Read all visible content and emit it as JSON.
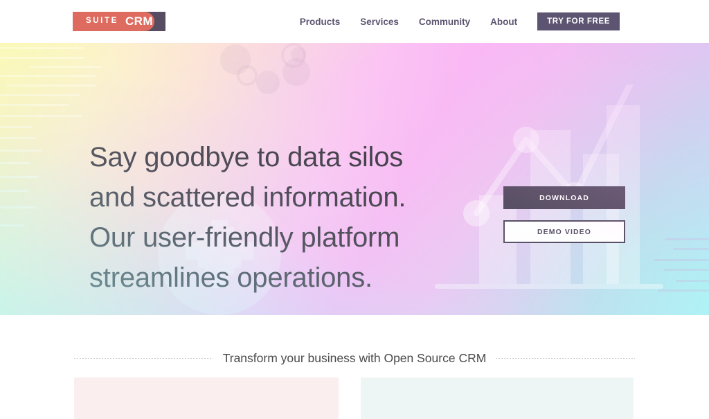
{
  "header": {
    "logo": {
      "left_text": "SUITE",
      "right_text": "CRM",
      "left_color": "#DE6B60",
      "right_color": "#574D63"
    },
    "nav_items": [
      {
        "label": "Products"
      },
      {
        "label": "Services"
      },
      {
        "label": "Community"
      },
      {
        "label": "About"
      }
    ],
    "cta_label": "TRY FOR FREE"
  },
  "hero": {
    "headline": "Say goodbye to data silos and scattered information. Our user-friendly platform streamlines operations.",
    "buttons": {
      "primary": "DOWNLOAD",
      "secondary": "DEMO VIDEO"
    },
    "carousel": {
      "total": 3,
      "active_index": 0
    },
    "gradient": {
      "top_left": "#FAF7B8",
      "top_right": "#F8BDF4",
      "bottom_left": "#AEF3F6",
      "bottom_right": "#FBC6EF"
    },
    "accent_dark": "#574F63"
  },
  "section": {
    "title": "Transform your business with Open Source CRM",
    "cards": [
      {
        "name": "card-left",
        "color": "#FBEEEE"
      },
      {
        "name": "card-right",
        "color": "#EEF6F5"
      }
    ]
  }
}
